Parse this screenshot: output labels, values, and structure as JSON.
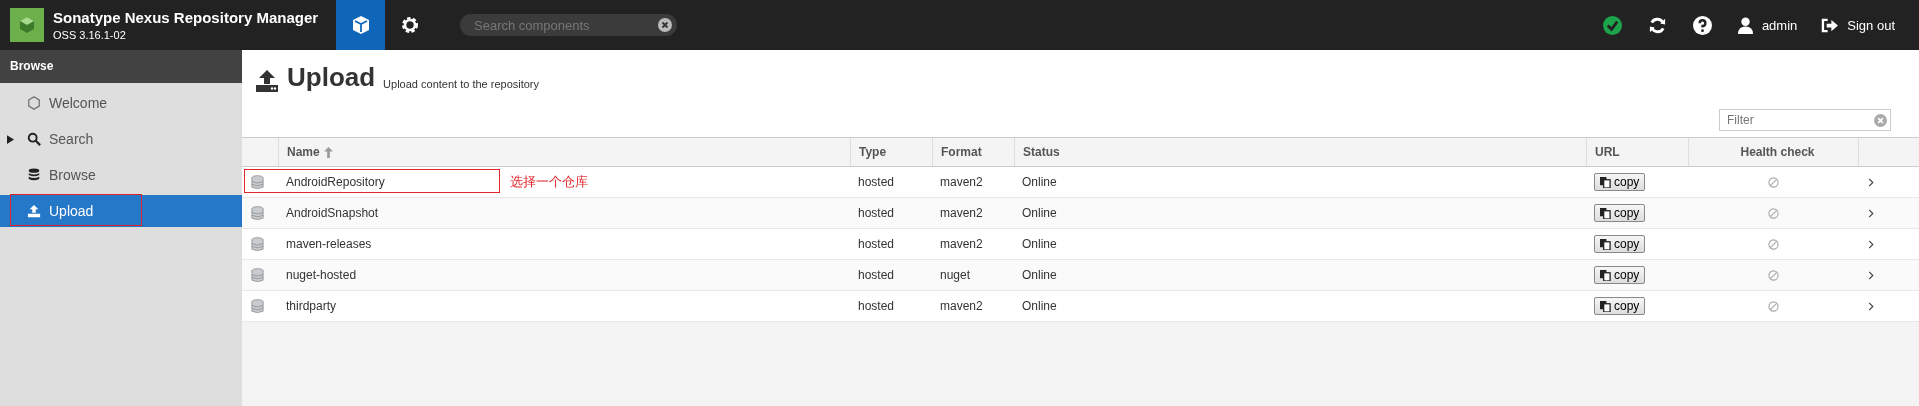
{
  "header": {
    "title": "Sonatype Nexus Repository Manager",
    "version": "OSS 3.16.1-02",
    "modes": [
      {
        "kind": "browse",
        "selected": true
      },
      {
        "kind": "admin",
        "selected": false
      }
    ],
    "search": {
      "placeholder": "Search components"
    },
    "user": "admin",
    "sign_out": "Sign out"
  },
  "sidebar": {
    "title": "Browse",
    "items": [
      {
        "label": "Welcome",
        "kind": "welcome",
        "expandable": false,
        "selected": false,
        "highlighted": false
      },
      {
        "label": "Search",
        "kind": "search",
        "expandable": true,
        "selected": false,
        "highlighted": false
      },
      {
        "label": "Browse",
        "kind": "browse",
        "expandable": false,
        "selected": false,
        "highlighted": false
      },
      {
        "label": "Upload",
        "kind": "upload",
        "expandable": false,
        "selected": true,
        "highlighted": true
      }
    ]
  },
  "page": {
    "title": "Upload",
    "subtitle": "Upload content to the repository"
  },
  "filter": {
    "placeholder": "Filter"
  },
  "table": {
    "columns": [
      "Name",
      "Type",
      "Format",
      "Status",
      "URL",
      "Health check"
    ],
    "rows": [
      {
        "name": "AndroidRepository",
        "type": "hosted",
        "format": "maven2",
        "status": "Online",
        "url": "copy",
        "highlighted": true,
        "annotation": "选择一个仓库"
      },
      {
        "name": "AndroidSnapshot",
        "type": "hosted",
        "format": "maven2",
        "status": "Online",
        "url": "copy",
        "highlighted": false
      },
      {
        "name": "maven-releases",
        "type": "hosted",
        "format": "maven2",
        "status": "Online",
        "url": "copy",
        "highlighted": false
      },
      {
        "name": "nuget-hosted",
        "type": "hosted",
        "format": "nuget",
        "status": "Online",
        "url": "copy",
        "highlighted": false
      },
      {
        "name": "thirdparty",
        "type": "hosted",
        "format": "maven2",
        "status": "Online",
        "url": "copy",
        "highlighted": false
      }
    ]
  }
}
